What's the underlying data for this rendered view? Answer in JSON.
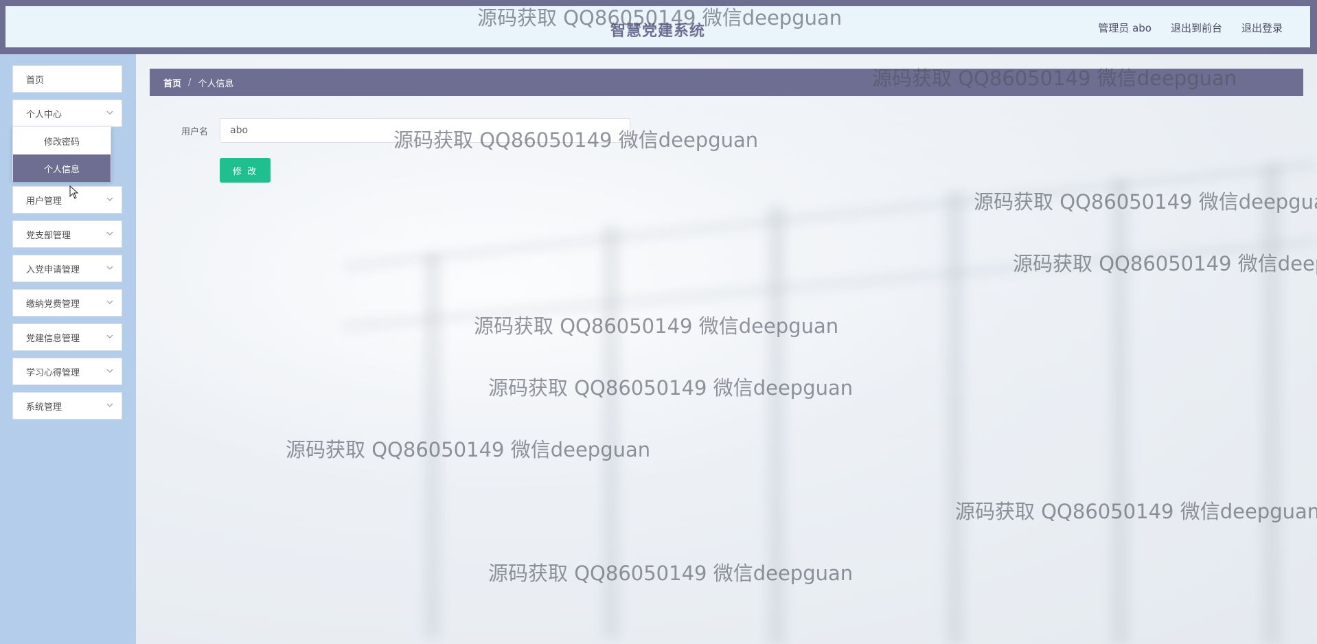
{
  "header": {
    "app_title": "智慧党建系统",
    "user_label": "管理员 abo",
    "front_link": "退出到前台",
    "logout_link": "退出登录"
  },
  "sidebar": {
    "items": [
      {
        "label": "首页"
      },
      {
        "label": "个人中心",
        "expanded": true
      },
      {
        "label": "用户管理"
      },
      {
        "label": "党支部管理"
      },
      {
        "label": "入党申请管理"
      },
      {
        "label": "缴纳党费管理"
      },
      {
        "label": "党建信息管理"
      },
      {
        "label": "学习心得管理"
      },
      {
        "label": "系统管理"
      }
    ],
    "submenu": [
      {
        "label": "修改密码"
      },
      {
        "label": "个人信息",
        "active": true
      }
    ]
  },
  "breadcrumb": {
    "home": "首页",
    "separator": "/",
    "current": "个人信息"
  },
  "form": {
    "username_label": "用户名",
    "username_value": "abo",
    "submit_label": "修 改"
  },
  "watermark": {
    "text": "源码获取 QQ86050149 微信deepguan"
  },
  "colors": {
    "header_bg": "#6e6e93",
    "sidebar_bg": "#b3cdeb",
    "active_item": "#6e6e93",
    "primary_button": "#1fbf8f"
  }
}
